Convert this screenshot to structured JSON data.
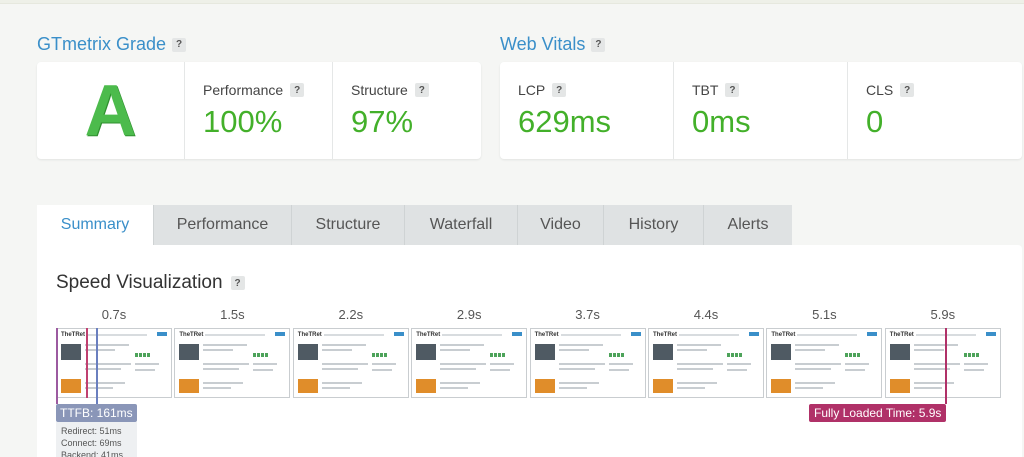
{
  "grade_section": {
    "title": "GTmetrix Grade",
    "help": "?",
    "grade": "A",
    "metrics": [
      {
        "label": "Performance",
        "value": "100%"
      },
      {
        "label": "Structure",
        "value": "97%"
      }
    ]
  },
  "vitals_section": {
    "title": "Web Vitals",
    "help": "?",
    "metrics": [
      {
        "label": "LCP",
        "value": "629ms"
      },
      {
        "label": "TBT",
        "value": "0ms"
      },
      {
        "label": "CLS",
        "value": "0"
      }
    ]
  },
  "tabs": [
    {
      "label": "Summary",
      "active": true
    },
    {
      "label": "Performance"
    },
    {
      "label": "Structure"
    },
    {
      "label": "Waterfall"
    },
    {
      "label": "Video"
    },
    {
      "label": "History"
    },
    {
      "label": "Alerts"
    }
  ],
  "speed": {
    "title": "Speed Visualization",
    "help": "?",
    "times": [
      "0.7s",
      "1.5s",
      "2.2s",
      "2.9s",
      "3.7s",
      "4.4s",
      "5.1s",
      "5.9s"
    ],
    "frame_logo": "TheTRet",
    "ttfb_label": "TTFB: 161ms",
    "ttfb_details": [
      "Redirect: 51ms",
      "Connect: 69ms",
      "Backend: 41ms"
    ],
    "fully_loaded_label": "Fully Loaded Time: 5.9s"
  },
  "colors": {
    "accent": "#3a8fc9",
    "good": "#43b02a",
    "ttfb": "#8a96b8",
    "fully_loaded": "#b03168"
  }
}
